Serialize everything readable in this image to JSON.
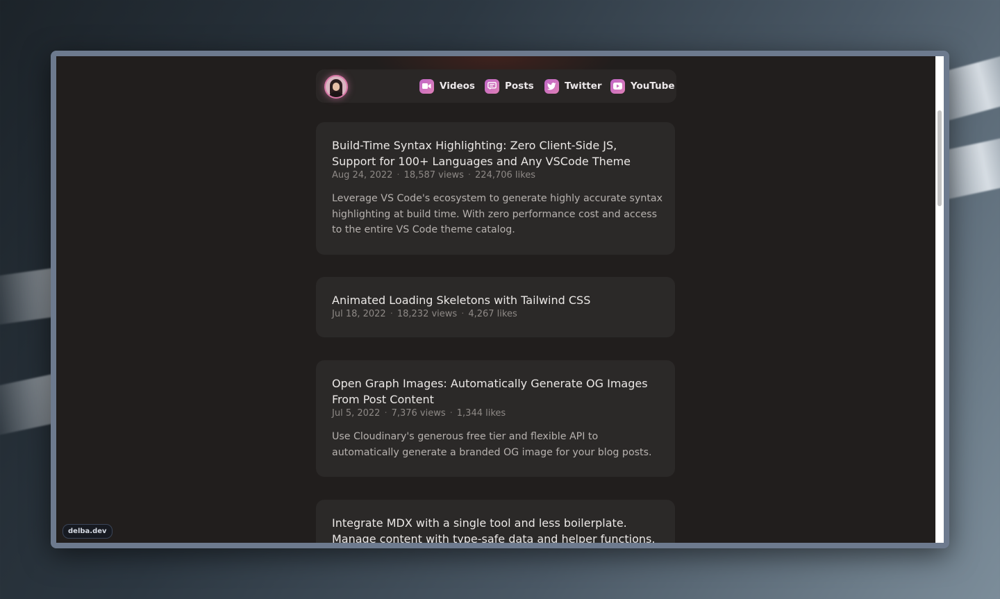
{
  "badge": "delba.dev",
  "nav": {
    "items": [
      {
        "label": "Videos",
        "icon": "video-icon"
      },
      {
        "label": "Posts",
        "icon": "message-icon"
      },
      {
        "label": "Twitter",
        "icon": "twitter-icon"
      },
      {
        "label": "YouTube",
        "icon": "youtube-icon"
      }
    ]
  },
  "posts": [
    {
      "title_lines": [
        "Build-Time Syntax Highlighting: Zero Client-Side JS,",
        "Support for 100+ Languages and Any VSCode Theme"
      ],
      "date": "Aug 24, 2022",
      "views": "18,587 views",
      "likes": "224,706 likes",
      "desc_lines": [
        "Leverage VS Code's ecosystem to generate highly accurate syntax",
        "highlighting at build time. With zero performance cost and access",
        "to the entire VS Code theme catalog."
      ]
    },
    {
      "title_lines": [
        "Animated Loading Skeletons with Tailwind CSS"
      ],
      "date": "Jul 18, 2022",
      "views": "18,232 views",
      "likes": "4,267 likes",
      "desc_lines": []
    },
    {
      "title_lines": [
        "Open Graph Images: Automatically Generate OG Images",
        "From Post Content"
      ],
      "date": "Jul 5, 2022",
      "views": "7,376 views",
      "likes": "1,344 likes",
      "desc_lines": [
        "Use Cloudinary's generous free tier and flexible API to",
        "automatically generate a branded OG image for your blog posts."
      ]
    },
    {
      "title_lines": [
        "Integrate MDX with a single tool and less boilerplate.",
        "Manage content with type-safe data and helper functions."
      ],
      "date": "",
      "views": "",
      "likes": "",
      "desc_lines": []
    }
  ],
  "colors": {
    "accent_pink": "#d876a6",
    "icon_gradient_start": "#c066c6",
    "card_bg": "#2b2928",
    "page_bg": "#211e1d"
  }
}
